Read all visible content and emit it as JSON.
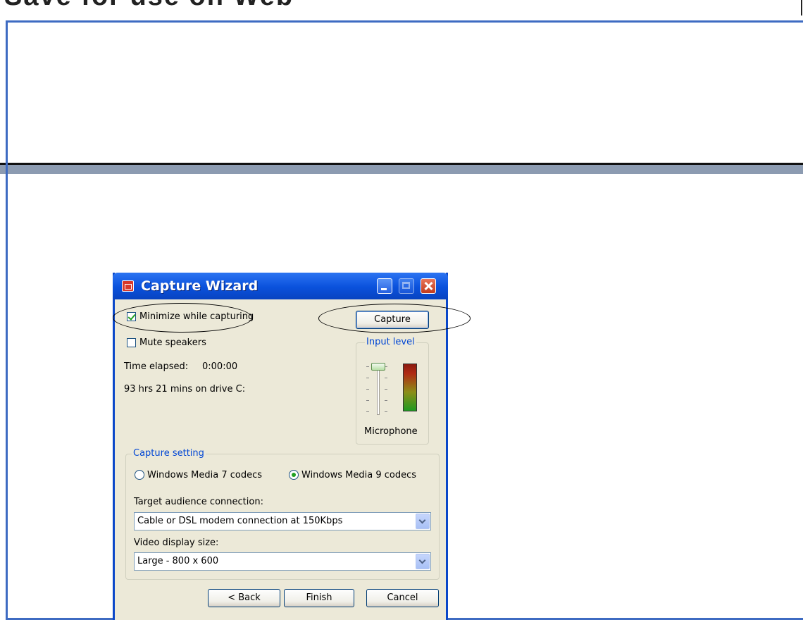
{
  "slide": {
    "title_fragment": "Save for use on Web"
  },
  "dialog": {
    "title": "Capture Wizard",
    "minimize_checkbox": {
      "label": "Minimize while capturing",
      "checked": true
    },
    "mute_checkbox": {
      "label": "Mute speakers",
      "checked": false
    },
    "time_elapsed_label": "Time elapsed:",
    "time_elapsed_value": "0:00:00",
    "disk_space": "93 hrs 21 mins on drive C:",
    "capture_button": "Capture",
    "input_level": {
      "title": "Input level",
      "source_label": "Microphone"
    },
    "capture_setting": {
      "title": "Capture setting",
      "options": [
        {
          "label": "Windows Media 7 codecs",
          "selected": false
        },
        {
          "label": "Windows Media 9 codecs",
          "selected": true
        }
      ],
      "target_label": "Target audience connection:",
      "target_value": "Cable or DSL modem connection at 150Kbps",
      "size_label": "Video display size:",
      "size_value": "Large - 800 x 600"
    },
    "buttons": {
      "back": "< Back",
      "finish": "Finish",
      "cancel": "Cancel"
    }
  },
  "colors": {
    "frame": "#3e6bc2",
    "xp_titlebar": "#0a51dc",
    "dialog_bg": "#ece9d8",
    "group_title": "#0046d5"
  }
}
